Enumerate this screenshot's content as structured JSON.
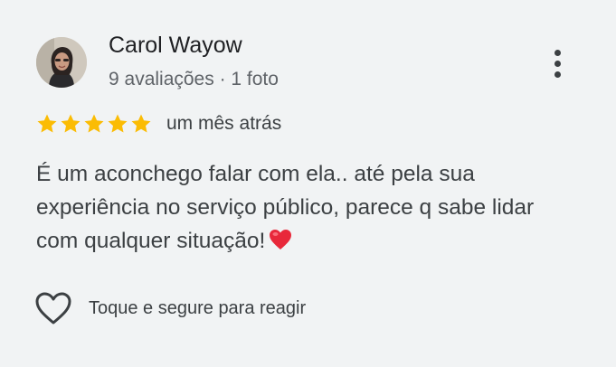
{
  "reviewer": {
    "name": "Carol Wayow",
    "meta": "9 avaliações · 1 foto"
  },
  "rating": {
    "stars": 5,
    "max_stars": 5,
    "star_color": "#fbbc04",
    "date": "um mês atrás"
  },
  "review": {
    "text": "É um aconchego falar com ela.. até pela sua experiência no serviço público, parece q sabe lidar com qualquer situação!",
    "emoji": "red-heart-emoji"
  },
  "reaction": {
    "label": "Toque e segure para reagir",
    "icon": "heart-outline-icon"
  },
  "menu": {
    "icon": "more-vert-icon"
  }
}
